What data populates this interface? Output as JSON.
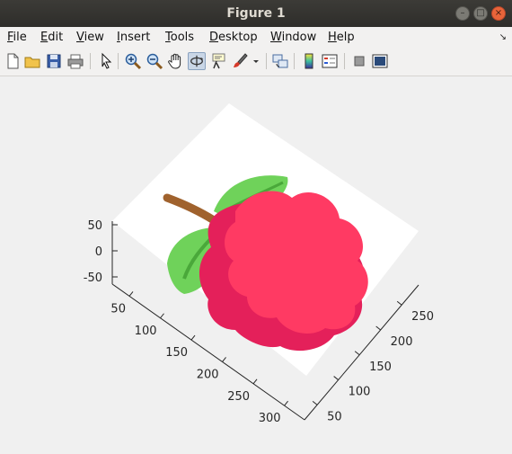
{
  "window": {
    "title": "Figure 1"
  },
  "menu": [
    {
      "name": "menu-file",
      "underline": "F",
      "rest": "ile"
    },
    {
      "name": "menu-edit",
      "underline": "E",
      "rest": "dit"
    },
    {
      "name": "menu-view",
      "underline": "V",
      "rest": "iew"
    },
    {
      "name": "menu-insert",
      "underline": "I",
      "rest": "nsert"
    },
    {
      "name": "menu-tools",
      "underline": "T",
      "rest": "ools"
    },
    {
      "name": "menu-desktop",
      "underline": "D",
      "rest": "esktop"
    },
    {
      "name": "menu-window",
      "underline": "W",
      "rest": "indow"
    },
    {
      "name": "menu-help",
      "underline": "H",
      "rest": "elp"
    }
  ],
  "toolbar": {
    "tools": [
      "new-figure",
      "open-file",
      "save",
      "print",
      "edit-plot-pointer",
      "zoom-in",
      "zoom-out",
      "pan",
      "rotate-3d",
      "data-cursor",
      "brush",
      "brush-dropdown",
      "link-plot",
      "insert-colorbar",
      "insert-legend",
      "hide-plot-tools",
      "show-plot-tools"
    ],
    "active_tool": "rotate-3d"
  },
  "axes": {
    "z_ticks": [
      "50",
      "0",
      "-50"
    ],
    "y_ticks": [
      "50",
      "100",
      "150",
      "200",
      "250",
      "300"
    ],
    "x_ticks": [
      "50",
      "100",
      "150",
      "200",
      "250"
    ]
  },
  "image": {
    "subject": "raspberry-illustration",
    "colors": {
      "berry_light": "#ff3a63",
      "berry_dark": "#e4205a",
      "leaf_light": "#6fd25a",
      "leaf_dark": "#4aa83a",
      "stem": "#a0622d"
    }
  }
}
